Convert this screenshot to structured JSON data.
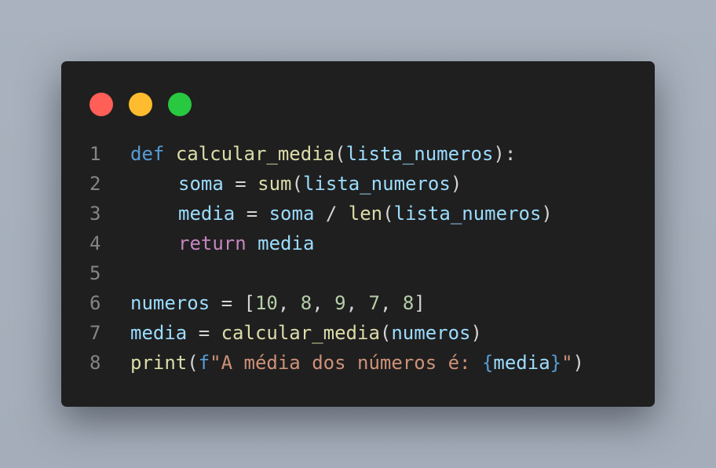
{
  "colors": {
    "background": "#a9b2be",
    "window": "#1f1f1f",
    "dot_red": "#ff5f57",
    "dot_yellow": "#febc2e",
    "dot_green": "#28c840"
  },
  "window_controls": [
    "close-dot",
    "minimize-dot",
    "maximize-dot"
  ],
  "code": {
    "lines": [
      {
        "number": "1",
        "indent": false,
        "tokens": [
          {
            "t": "def",
            "c": "kw"
          },
          {
            "t": " ",
            "c": "op"
          },
          {
            "t": "calcular_media",
            "c": "fn"
          },
          {
            "t": "(",
            "c": "op"
          },
          {
            "t": "lista_numeros",
            "c": "var"
          },
          {
            "t": "):",
            "c": "op"
          }
        ]
      },
      {
        "number": "2",
        "indent": true,
        "tokens": [
          {
            "t": "soma",
            "c": "var"
          },
          {
            "t": " = ",
            "c": "op"
          },
          {
            "t": "sum",
            "c": "fn"
          },
          {
            "t": "(",
            "c": "op"
          },
          {
            "t": "lista_numeros",
            "c": "var"
          },
          {
            "t": ")",
            "c": "op"
          }
        ]
      },
      {
        "number": "3",
        "indent": true,
        "tokens": [
          {
            "t": "media",
            "c": "var"
          },
          {
            "t": " = ",
            "c": "op"
          },
          {
            "t": "soma",
            "c": "var"
          },
          {
            "t": " / ",
            "c": "op"
          },
          {
            "t": "len",
            "c": "fn"
          },
          {
            "t": "(",
            "c": "op"
          },
          {
            "t": "lista_numeros",
            "c": "var"
          },
          {
            "t": ")",
            "c": "op"
          }
        ]
      },
      {
        "number": "4",
        "indent": true,
        "tokens": [
          {
            "t": "return",
            "c": "ctrl"
          },
          {
            "t": " ",
            "c": "op"
          },
          {
            "t": "media",
            "c": "var"
          }
        ]
      },
      {
        "number": "5",
        "indent": false,
        "tokens": []
      },
      {
        "number": "6",
        "indent": false,
        "tokens": [
          {
            "t": "numeros",
            "c": "var"
          },
          {
            "t": " = [",
            "c": "op"
          },
          {
            "t": "10",
            "c": "num"
          },
          {
            "t": ", ",
            "c": "op"
          },
          {
            "t": "8",
            "c": "num"
          },
          {
            "t": ", ",
            "c": "op"
          },
          {
            "t": "9",
            "c": "num"
          },
          {
            "t": ", ",
            "c": "op"
          },
          {
            "t": "7",
            "c": "num"
          },
          {
            "t": ", ",
            "c": "op"
          },
          {
            "t": "8",
            "c": "num"
          },
          {
            "t": "]",
            "c": "op"
          }
        ]
      },
      {
        "number": "7",
        "indent": false,
        "tokens": [
          {
            "t": "media",
            "c": "var"
          },
          {
            "t": " = ",
            "c": "op"
          },
          {
            "t": "calcular_media",
            "c": "fn"
          },
          {
            "t": "(",
            "c": "op"
          },
          {
            "t": "numeros",
            "c": "var"
          },
          {
            "t": ")",
            "c": "op"
          }
        ]
      },
      {
        "number": "8",
        "indent": false,
        "tokens": [
          {
            "t": "print",
            "c": "fn"
          },
          {
            "t": "(",
            "c": "op"
          },
          {
            "t": "f",
            "c": "kw"
          },
          {
            "t": "\"A média dos números é: ",
            "c": "str"
          },
          {
            "t": "{",
            "c": "brace"
          },
          {
            "t": "media",
            "c": "var"
          },
          {
            "t": "}",
            "c": "brace"
          },
          {
            "t": "\"",
            "c": "str"
          },
          {
            "t": ")",
            "c": "op"
          }
        ]
      }
    ]
  }
}
